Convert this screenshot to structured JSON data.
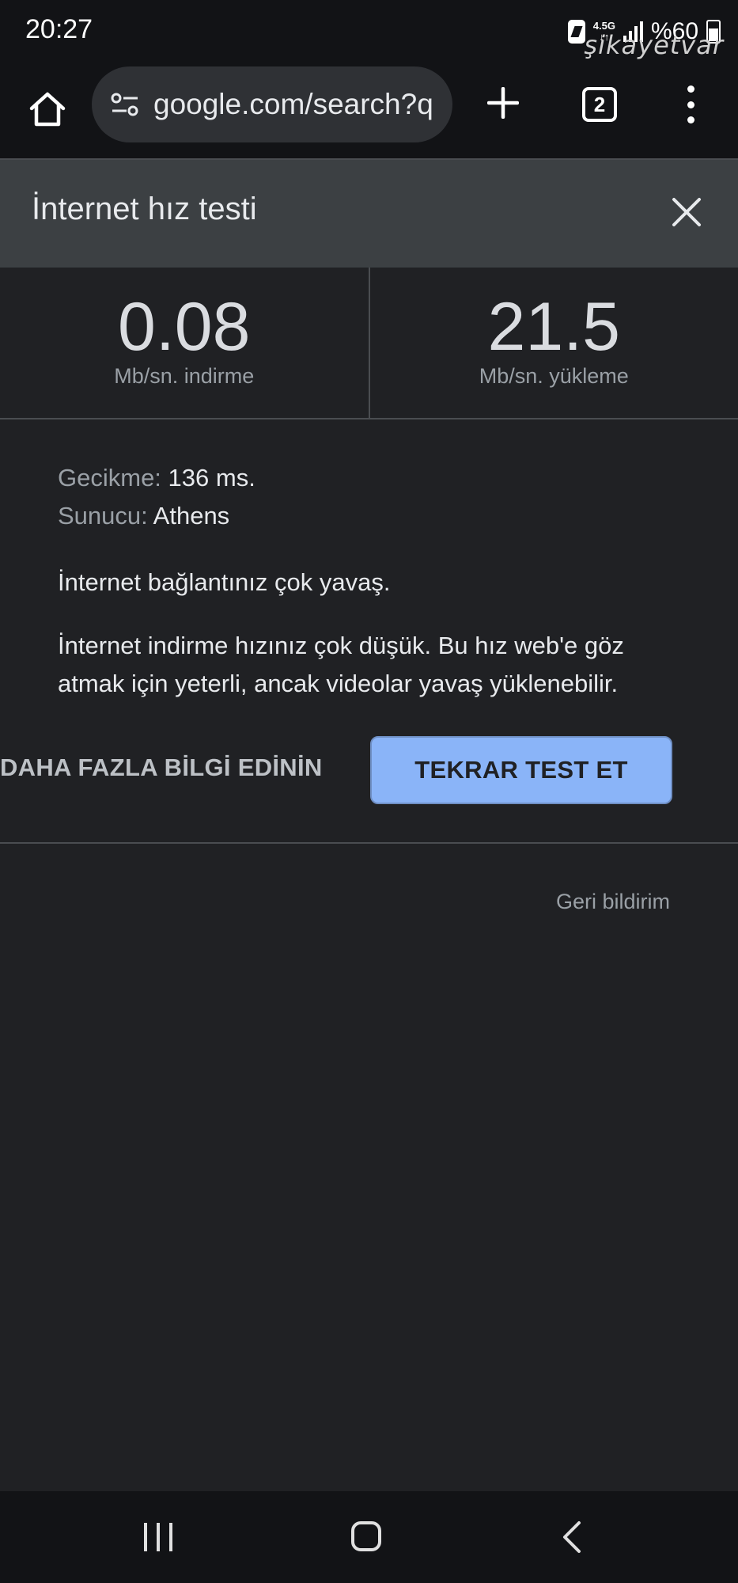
{
  "status_bar": {
    "time": "20:27",
    "network_type": "4.5G",
    "battery_percent": "%60",
    "watermark": "şikayetvar"
  },
  "toolbar": {
    "url": "google.com/search?q",
    "tab_count": "2",
    "icons": [
      "home-icon",
      "site-settings-icon",
      "plus-icon",
      "tab-switcher-icon",
      "more-vert-icon"
    ]
  },
  "panel": {
    "title": "İnternet hız testi",
    "download": {
      "value": "0.08",
      "unit": "Mb/sn. indirme"
    },
    "upload": {
      "value": "21.5",
      "unit": "Mb/sn. yükleme"
    },
    "latency_label": "Gecikme:",
    "latency_value": "136 ms.",
    "server_label": "Sunucu:",
    "server_value": "Athens",
    "message_short": "İnternet bağlantınız çok yavaş.",
    "message_long": "İnternet indirme hızınız çok düşük. Bu hız web'e göz atmak için yeterli, ancak videolar yavaş yüklenebilir.",
    "learn_more_label": "DAHA FAZLA BİLGİ EDİNİN",
    "retest_label": "TEKRAR TEST ET",
    "feedback_label": "Geri bildirim"
  },
  "colors": {
    "background": "#202124",
    "header": "#3c4043",
    "accent_button": "#8ab4f8",
    "bars": "#121316"
  }
}
